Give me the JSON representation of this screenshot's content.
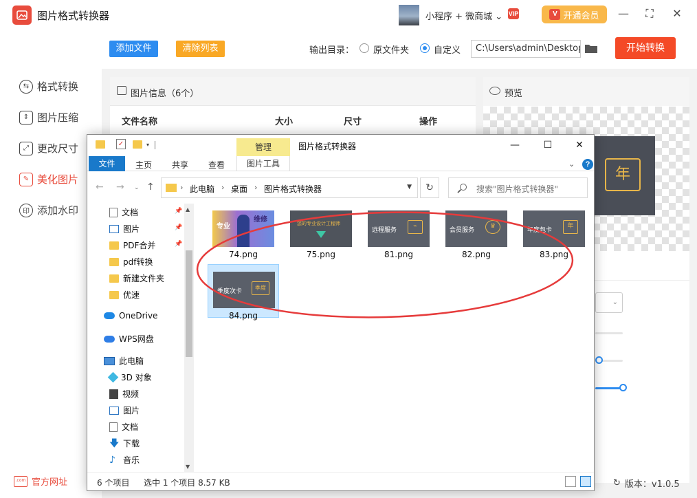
{
  "app": {
    "title": "图片格式转换器",
    "promo": "小程序 + 微商城 ⌄",
    "vip_badge": "VIP",
    "vip_button": "开通会员",
    "vip_icon": "V"
  },
  "sidebar": {
    "items": [
      {
        "label": "格式转换",
        "icon": "format-convert-icon"
      },
      {
        "label": "图片压缩",
        "icon": "compress-icon"
      },
      {
        "label": "更改尺寸",
        "icon": "resize-icon"
      },
      {
        "label": "美化图片",
        "icon": "beautify-icon"
      },
      {
        "label": "添加水印",
        "icon": "watermark-icon"
      }
    ],
    "official_site": "官方网址",
    "official_site_icon_text": ".com"
  },
  "toolbar": {
    "add_files": "添加文件",
    "clear_list": "清除列表",
    "output_label": "输出目录：",
    "radio_original": "原文件夹",
    "radio_custom": "自定义",
    "output_path": "C:\\Users\\admin\\Desktop",
    "start": "开始转换"
  },
  "info_panel": {
    "title": "图片信息（6个）",
    "columns": [
      "文件名称",
      "大小",
      "尺寸",
      "操作"
    ]
  },
  "preview": {
    "title": "预览",
    "year_char": "年"
  },
  "version": "版本：v1.0.5",
  "explorer": {
    "manage_tab": "管理",
    "title": "图片格式转换器",
    "ribbon": {
      "file": "文件",
      "home": "主页",
      "share": "共享",
      "view": "查看",
      "picture_tools": "图片工具"
    },
    "breadcrumb": [
      "此电脑",
      "桌面",
      "图片格式转换器"
    ],
    "search_placeholder": "搜索\"图片格式转换器\"",
    "nav": [
      {
        "label": "文档",
        "icon": "doc",
        "pinned": true
      },
      {
        "label": "图片",
        "icon": "pic",
        "pinned": true
      },
      {
        "label": "PDF合并",
        "icon": "folder",
        "pinned": true
      },
      {
        "label": "pdf转换",
        "icon": "folder"
      },
      {
        "label": "新建文件夹",
        "icon": "folder"
      },
      {
        "label": "优速",
        "icon": "folder"
      },
      {
        "label": "OneDrive",
        "icon": "cloud"
      },
      {
        "label": "WPS网盘",
        "icon": "cloud"
      },
      {
        "label": "此电脑",
        "icon": "pc"
      },
      {
        "label": "3D 对象",
        "icon": "3d"
      },
      {
        "label": "视频",
        "icon": "video"
      },
      {
        "label": "图片",
        "icon": "pic"
      },
      {
        "label": "文档",
        "icon": "doc"
      },
      {
        "label": "下载",
        "icon": "down"
      },
      {
        "label": "音乐",
        "icon": "music"
      }
    ],
    "files": [
      {
        "name": "74.png",
        "thumb_text_1": "专业",
        "thumb_text_2": "维修"
      },
      {
        "name": "75.png",
        "thumb_text": "您的专业设计工程师"
      },
      {
        "name": "81.png",
        "thumb_text": "远程服务"
      },
      {
        "name": "82.png",
        "thumb_text": "会员服务"
      },
      {
        "name": "83.png",
        "thumb_text": "年度包卡",
        "box_char": "年"
      },
      {
        "name": "84.png",
        "thumb_text": "季度次卡",
        "box_char": "季度",
        "selected": true
      }
    ],
    "status": {
      "count": "6 个项目",
      "selection": "选中 1 个项目  8.57 KB"
    }
  }
}
